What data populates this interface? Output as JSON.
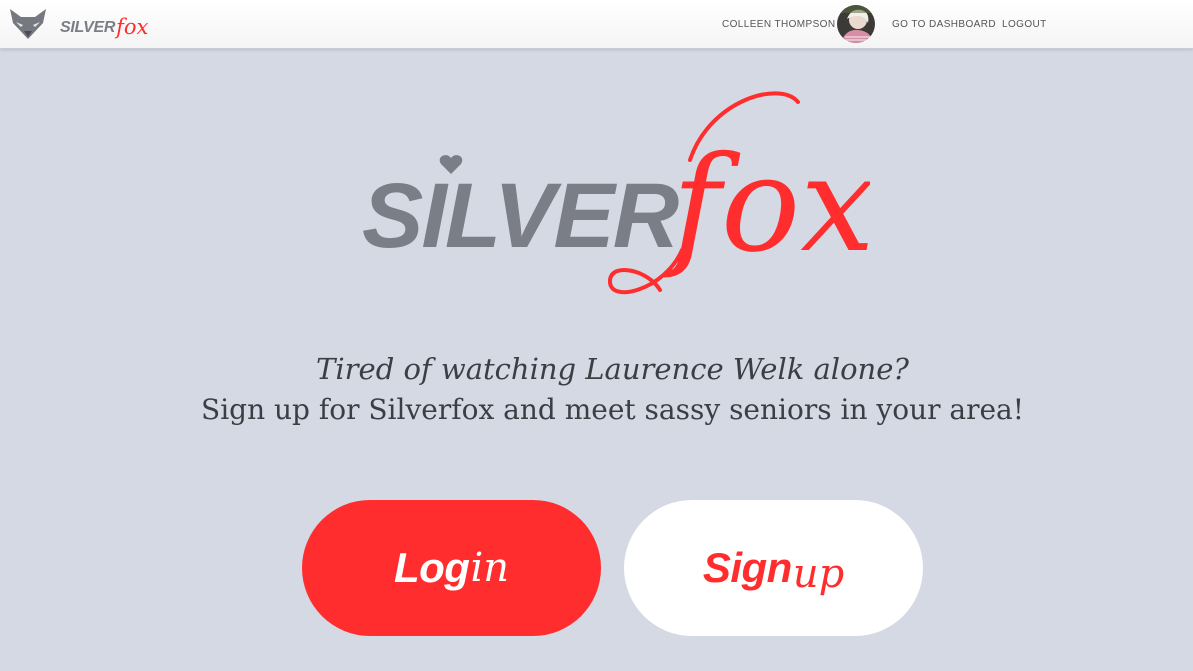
{
  "brand": {
    "silver": "SILVER",
    "fox": "fox",
    "logo_icon": "fox-head-icon"
  },
  "nav": {
    "user_name": "COLLEEN THOMPSON",
    "avatar_icon": "user-avatar",
    "dashboard_label": "GO TO DASHBOARD",
    "logout_label": "LOGOUT"
  },
  "hero": {
    "logo_silver": "SILVER",
    "logo_fox": "fox",
    "tagline_line1": "Tired of watching Laurence Welk alone?",
    "tagline_line2": "Sign up for Silverfox and meet sassy seniors in your area!"
  },
  "actions": {
    "login_bold": "Log",
    "login_script": "in",
    "signup_bold": "Sign",
    "signup_script": "up"
  },
  "colors": {
    "accent_red": "#ff2d2d",
    "logo_gray": "#7b7e86",
    "background": "#d4d9e4",
    "topbar": "#ffffff"
  }
}
